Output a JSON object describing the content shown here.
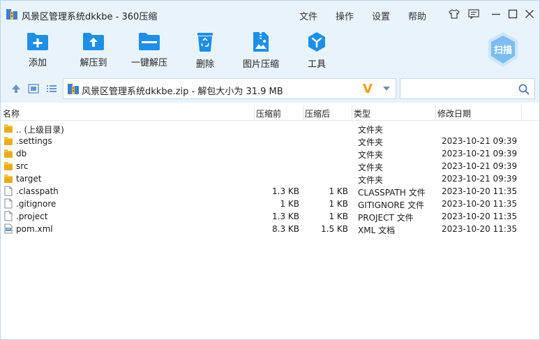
{
  "window": {
    "title": "风景区管理系统dkkbe - 360压缩",
    "menus": [
      "文件",
      "操作",
      "设置",
      "帮助"
    ]
  },
  "toolbar": {
    "add": "添加",
    "extract_to": "解压到",
    "one_click_extract": "一键解压",
    "delete": "删除",
    "image_compress": "图片压缩",
    "tools": "工具",
    "scan": "扫描"
  },
  "address": {
    "text": "风景区管理系统dkkbe.zip - 解包大小为 31.9 MB",
    "search_placeholder": ""
  },
  "columns": {
    "name": "名称",
    "original_size": "压缩前",
    "compressed_size": "压缩后",
    "type": "类型",
    "modified": "修改日期"
  },
  "files": [
    {
      "name": ".. (上级目录)",
      "original": "",
      "compressed": "",
      "type": "文件夹",
      "date": "",
      "icon": "folder-icon"
    },
    {
      "name": ".settings",
      "original": "",
      "compressed": "",
      "type": "文件夹",
      "date": "2023-10-21 09:39",
      "icon": "folder-icon"
    },
    {
      "name": "db",
      "original": "",
      "compressed": "",
      "type": "文件夹",
      "date": "2023-10-21 09:39",
      "icon": "folder-icon"
    },
    {
      "name": "src",
      "original": "",
      "compressed": "",
      "type": "文件夹",
      "date": "2023-10-21 09:39",
      "icon": "folder-icon"
    },
    {
      "name": "target",
      "original": "",
      "compressed": "",
      "type": "文件夹",
      "date": "2023-10-21 09:39",
      "icon": "folder-icon"
    },
    {
      "name": ".classpath",
      "original": "1.3 KB",
      "compressed": "1 KB",
      "type": "CLASSPATH 文件",
      "date": "2023-10-20 11:35",
      "icon": "file-icon"
    },
    {
      "name": ".gitignore",
      "original": "1 KB",
      "compressed": "1 KB",
      "type": "GITIGNORE 文件",
      "date": "2023-10-20 11:35",
      "icon": "file-icon"
    },
    {
      "name": ".project",
      "original": "1.3 KB",
      "compressed": "1 KB",
      "type": "PROJECT 文件",
      "date": "2023-10-20 11:35",
      "icon": "file-icon"
    },
    {
      "name": "pom.xml",
      "original": "8.3 KB",
      "compressed": "1.5 KB",
      "type": "XML 文档",
      "date": "2023-10-20 11:35",
      "icon": "xml-file-icon"
    }
  ],
  "colors": {
    "chrome_bg": "#e9f3fc",
    "accent_blue": "#1e8fe6",
    "folder_yellow": "#f5c242",
    "v_orange": "#f39c12"
  }
}
